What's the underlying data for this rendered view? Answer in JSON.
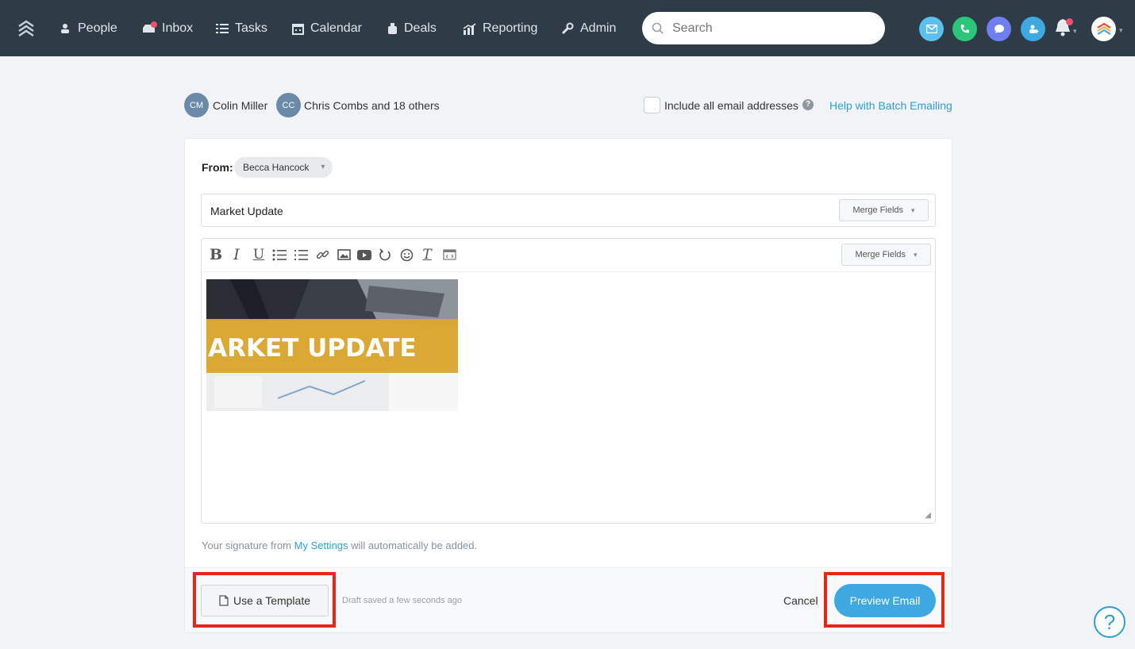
{
  "nav": {
    "items": [
      {
        "label": "People",
        "icon": "person-icon"
      },
      {
        "label": "Inbox",
        "icon": "inbox-icon"
      },
      {
        "label": "Tasks",
        "icon": "tasks-list-icon"
      },
      {
        "label": "Calendar",
        "icon": "calendar-icon"
      },
      {
        "label": "Deals",
        "icon": "deals-bag-icon"
      },
      {
        "label": "Reporting",
        "icon": "reporting-chart-icon"
      },
      {
        "label": "Admin",
        "icon": "wrench-icon"
      }
    ],
    "search_placeholder": "Search",
    "quick_actions": [
      {
        "icon": "email-icon",
        "color": "#5bc0f0"
      },
      {
        "icon": "phone-icon",
        "color": "#2bc67a"
      },
      {
        "icon": "chat-icon",
        "color": "#6f7ff0"
      },
      {
        "icon": "add-person-icon",
        "color": "#3fa8e0"
      }
    ]
  },
  "recipients": {
    "people": [
      {
        "initials": "CM",
        "name": "Colin Miller"
      },
      {
        "initials": "CC",
        "name": "Chris Combs"
      }
    ],
    "others_text": "and 18 others",
    "include_all_label": "Include all email addresses",
    "help_link": "Help with Batch Emailing"
  },
  "composer": {
    "from_label": "From:",
    "from_value": "Becca Hancock",
    "subject": "Market Update",
    "merge_fields_label": "Merge Fields",
    "banner_text": "MARKET UPDATE",
    "toolbar": [
      "bold-icon",
      "italic-icon",
      "underline-icon",
      "bullet-list-icon",
      "numbered-list-icon",
      "link-icon",
      "image-icon",
      "video-icon",
      "undo-icon",
      "emoji-icon",
      "clear-format-icon",
      "source-code-icon"
    ],
    "signature_prefix": "Your signature from",
    "signature_link": "My Settings",
    "signature_suffix": "will automatically be added."
  },
  "footer": {
    "template_button": "Use a Template",
    "draft_status": "Draft saved a few seconds ago",
    "cancel": "Cancel",
    "preview_button": "Preview Email"
  },
  "help_bubble": "?",
  "colors": {
    "nav_bg": "#2e3c48",
    "accent": "#3fa8e0",
    "highlight": "#e8251b"
  }
}
